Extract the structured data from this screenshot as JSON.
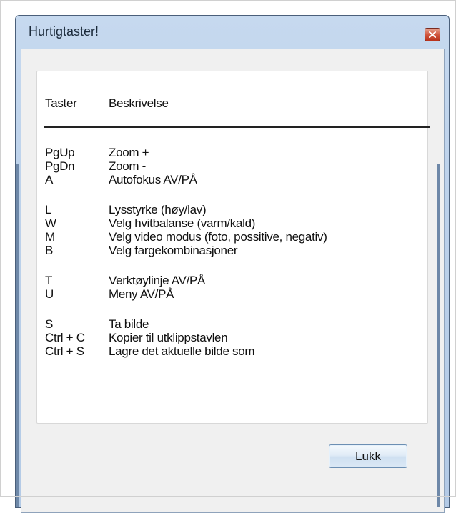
{
  "window": {
    "title": "Hurtigtaster!",
    "close_icon": "close-icon"
  },
  "table": {
    "headers": {
      "key": "Taster",
      "description": "Beskrivelse"
    },
    "rows": [
      {
        "key": "PgUp",
        "description": "Zoom +"
      },
      {
        "key": "PgDn",
        "description": "Zoom -"
      },
      {
        "key": "A",
        "description": "Autofokus AV/PÅ"
      },
      {
        "key": "L",
        "description": "Lysstyrke (høy/lav)"
      },
      {
        "key": "W",
        "description": "Velg hvitbalanse (varm/kald)"
      },
      {
        "key": "M",
        "description": "Velg video modus (foto, possitive, negativ)"
      },
      {
        "key": "B",
        "description": "Velg fargekombinasjoner"
      },
      {
        "key": "T",
        "description": "Verktøylinje AV/PÅ"
      },
      {
        "key": "U",
        "description": "Meny AV/PÅ"
      },
      {
        "key": "S",
        "description": "Ta bilde"
      },
      {
        "key": "Ctrl + C",
        "description": "Kopier til utklippstavlen"
      },
      {
        "key": "Ctrl + S",
        "description": "Lagre det aktuelle bilde som"
      }
    ]
  },
  "buttons": {
    "close_label": "Lukk"
  },
  "colors": {
    "title_bar": "#bcd1ea",
    "close_button": "#c8412a",
    "client": "#f0f0f0"
  }
}
